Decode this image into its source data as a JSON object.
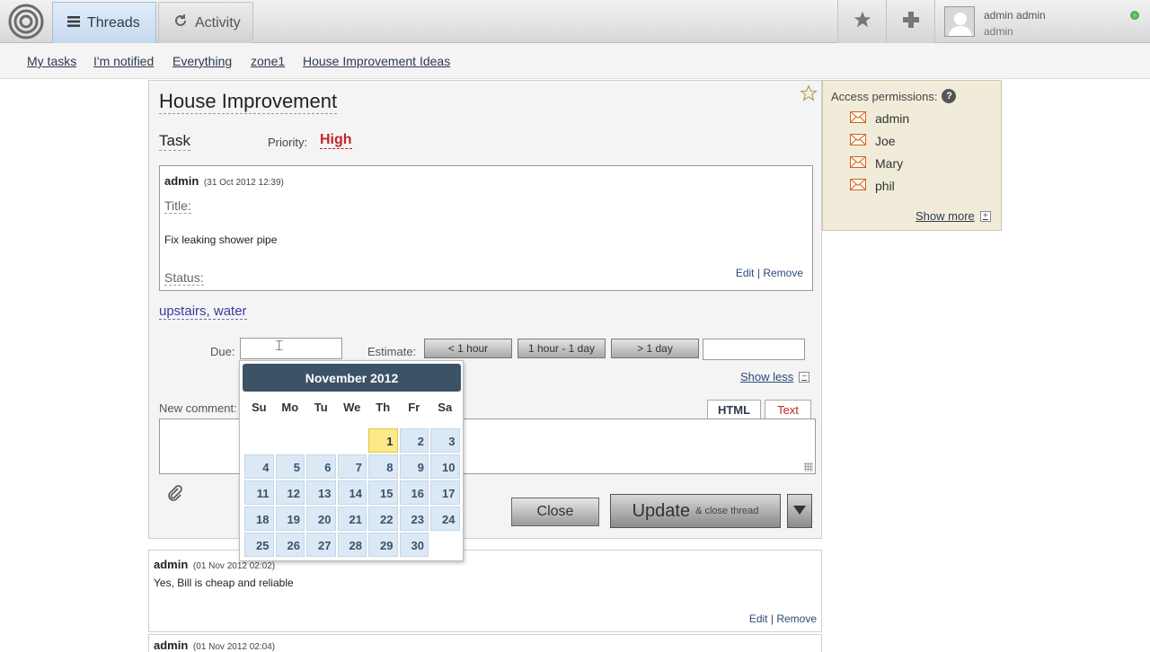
{
  "topbar": {
    "tabs": [
      {
        "label": "Threads",
        "icon": "list-icon",
        "active": true
      },
      {
        "label": "Activity",
        "icon": "refresh-icon",
        "active": false
      }
    ],
    "user": {
      "name": "admin admin",
      "sub": "admin",
      "status_color": "#2f8f2f"
    }
  },
  "nav": {
    "links": [
      "My tasks",
      "I'm notified",
      "Everything",
      "zone1",
      "House Improvement Ideas"
    ]
  },
  "task": {
    "title": "House Improvement",
    "type": "Task",
    "priority_label": "Priority:",
    "priority_value": "High",
    "description": {
      "author": "admin",
      "date": "(31 Oct 2012 12:39)",
      "title_label": "Title:",
      "title_value": "Fix leaking shower pipe",
      "status_label": "Status:",
      "edit": "Edit",
      "separator": "|",
      "remove": "Remove"
    },
    "tags": "upstairs, water",
    "due_label": "Due:",
    "due_value": "",
    "estimate_label": "Estimate:",
    "estimate_buttons": [
      "< 1 hour",
      "1 hour - 1 day",
      "> 1 day"
    ],
    "show_less": "Show less",
    "new_comment_label": "New comment:",
    "editor_tabs": [
      "HTML",
      "Text"
    ],
    "close_label": "Close",
    "update_label": "Update",
    "update_sub": "& close thread"
  },
  "calendar": {
    "month_label": "November 2012",
    "weekdays": [
      "Su",
      "Mo",
      "Tu",
      "We",
      "Th",
      "Fr",
      "Sa"
    ],
    "first_weekday_index": 4,
    "days_in_month": 30,
    "today": 1
  },
  "permissions": {
    "title": "Access permissions:",
    "help": "?",
    "users": [
      "admin",
      "Joe",
      "Mary",
      "phil"
    ],
    "show_more": "Show more"
  },
  "comments": [
    {
      "author": "admin",
      "date": "(01 Nov 2012 02:02)",
      "text": "Yes, Bill is cheap and reliable",
      "edit": "Edit",
      "separator": "|",
      "remove": "Remove"
    },
    {
      "author": "admin",
      "date": "(01 Nov 2012 02:04)"
    }
  ],
  "colors": {
    "accent": "#3c5267",
    "priority": "#c0262b",
    "calendar_day": "#dbe8f5",
    "calendar_today": "#fbe98a",
    "permissions_bg": "#f1ecd9"
  }
}
